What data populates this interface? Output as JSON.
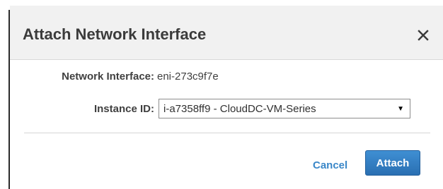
{
  "dialog": {
    "title": "Attach Network Interface",
    "close_icon": "close-icon"
  },
  "form": {
    "network_interface_label": "Network Interface:",
    "network_interface_value": "eni-273c9f7e",
    "instance_id_label": "Instance ID:",
    "instance_id_selected": "i-a7358ff9 - CloudDC-VM-Series",
    "dropdown_icon": "chevron-down-icon"
  },
  "actions": {
    "cancel_label": "Cancel",
    "attach_label": "Attach"
  },
  "colors": {
    "header_bg": "#f1f1f1",
    "link": "#3a87c8",
    "primary_button": "#2f7bc1",
    "title_text": "#3b3b3b"
  }
}
